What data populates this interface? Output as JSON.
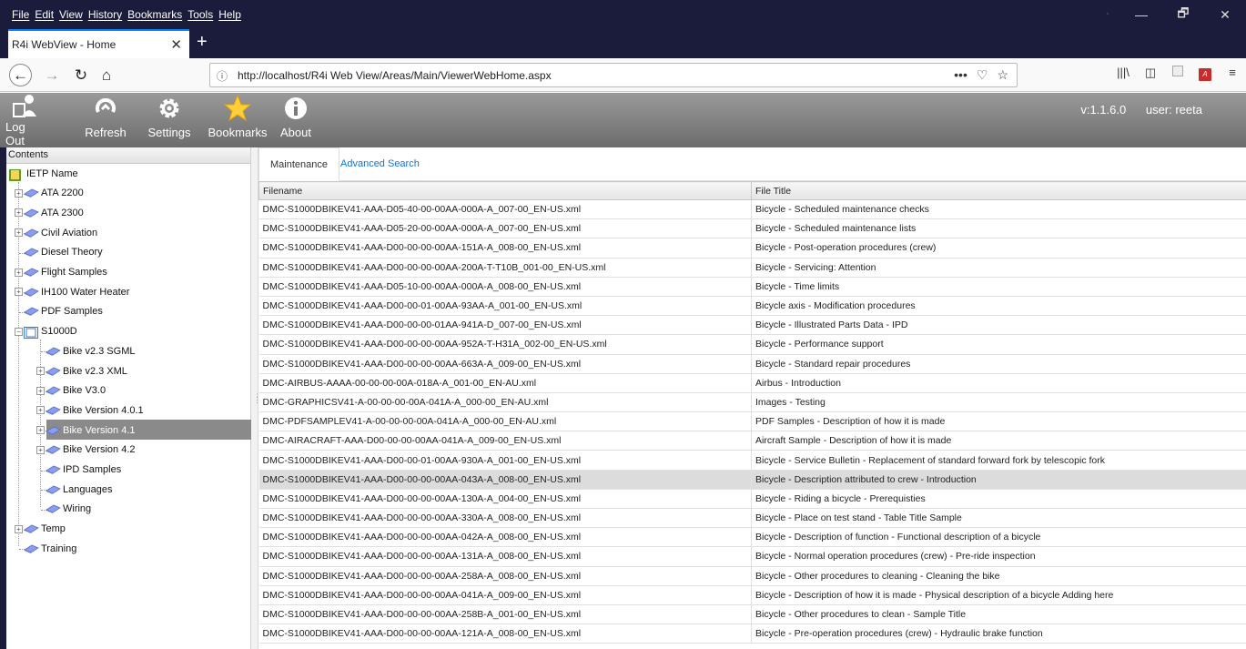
{
  "menubar": {
    "items": [
      "File",
      "Edit",
      "View",
      "History",
      "Bookmarks",
      "Tools",
      "Help"
    ]
  },
  "window_controls": {
    "minimize": "—",
    "maximize": "🗗",
    "close": "✕"
  },
  "browser": {
    "tab_title": "R4i WebView - Home",
    "url": "http://localhost/R4i Web View/Areas/Main/ViewerWebHome.aspx"
  },
  "toolbar": {
    "buttons": [
      {
        "label": "Log Out",
        "icon": "logout-icon"
      },
      {
        "label": "Refresh",
        "icon": "refresh-icon"
      },
      {
        "label": "Settings",
        "icon": "gear-icon"
      },
      {
        "label": "Bookmarks",
        "icon": "star-icon"
      },
      {
        "label": "About",
        "icon": "info-icon"
      }
    ],
    "version": "v:1.1.6.0",
    "user": "user: reeta"
  },
  "sidebar": {
    "header": "Contents",
    "tree": [
      {
        "label": "IETP Name",
        "level": 0,
        "icon": "root-book-icon"
      },
      {
        "label": "ATA 2200",
        "level": 1,
        "expandable": true
      },
      {
        "label": "ATA 2300",
        "level": 1,
        "expandable": true
      },
      {
        "label": "Civil Aviation",
        "level": 1,
        "expandable": true
      },
      {
        "label": "Diesel Theory",
        "level": 1,
        "expandable": false
      },
      {
        "label": "Flight Samples",
        "level": 1,
        "expandable": true
      },
      {
        "label": "IH100 Water Heater",
        "level": 1,
        "expandable": true
      },
      {
        "label": "PDF Samples",
        "level": 1,
        "expandable": false
      },
      {
        "label": "S1000D",
        "level": 1,
        "expandable": true,
        "expanded": true
      },
      {
        "label": "Bike v2.3 SGML",
        "level": 2,
        "expandable": false
      },
      {
        "label": "Bike v2.3 XML",
        "level": 2,
        "expandable": true
      },
      {
        "label": "Bike V3.0",
        "level": 2,
        "expandable": true
      },
      {
        "label": "Bike Version 4.0.1",
        "level": 2,
        "expandable": true
      },
      {
        "label": "Bike Version 4.1",
        "level": 2,
        "expandable": true,
        "selected": true
      },
      {
        "label": "Bike Version 4.2",
        "level": 2,
        "expandable": true
      },
      {
        "label": "IPD Samples",
        "level": 2,
        "expandable": false
      },
      {
        "label": "Languages",
        "level": 2,
        "expandable": false
      },
      {
        "label": "Wiring",
        "level": 2,
        "expandable": false
      },
      {
        "label": "Temp",
        "level": 1,
        "expandable": true
      },
      {
        "label": "Training",
        "level": 1,
        "expandable": false
      }
    ]
  },
  "main": {
    "tabs": [
      "Maintenance",
      "Advanced Search"
    ],
    "columns": [
      "Filename",
      "File Title"
    ],
    "rows": [
      [
        "DMC-S1000DBIKEV41-AAA-D05-40-00-00AA-000A-A_007-00_EN-US.xml",
        "Bicycle - Scheduled maintenance checks"
      ],
      [
        "DMC-S1000DBIKEV41-AAA-D05-20-00-00AA-000A-A_007-00_EN-US.xml",
        "Bicycle - Scheduled maintenance lists"
      ],
      [
        "DMC-S1000DBIKEV41-AAA-D00-00-00-00AA-151A-A_008-00_EN-US.xml",
        "Bicycle - Post-operation procedures (crew)"
      ],
      [
        "DMC-S1000DBIKEV41-AAA-D00-00-00-00AA-200A-T-T10B_001-00_EN-US.xml",
        "Bicycle - Servicing: Attention"
      ],
      [
        "DMC-S1000DBIKEV41-AAA-D05-10-00-00AA-000A-A_008-00_EN-US.xml",
        "Bicycle - Time limits"
      ],
      [
        "DMC-S1000DBIKEV41-AAA-D00-00-01-00AA-93AA-A_001-00_EN-US.xml",
        "Bicycle axis - Modification procedures"
      ],
      [
        "DMC-S1000DBIKEV41-AAA-D00-00-00-01AA-941A-D_007-00_EN-US.xml",
        "Bicycle - Illustrated Parts Data - IPD"
      ],
      [
        "DMC-S1000DBIKEV41-AAA-D00-00-00-00AA-952A-T-H31A_002-00_EN-US.xml",
        "Bicycle - Performance support"
      ],
      [
        "DMC-S1000DBIKEV41-AAA-D00-00-00-00AA-663A-A_009-00_EN-US.xml",
        "Bicycle - Standard repair procedures"
      ],
      [
        "DMC-AIRBUS-AAAA-00-00-00-00A-018A-A_001-00_EN-AU.xml",
        "Airbus - Introduction"
      ],
      [
        "DMC-GRAPHICSV41-A-00-00-00-00A-041A-A_000-00_EN-AU.xml",
        "Images - Testing"
      ],
      [
        "DMC-PDFSAMPLEV41-A-00-00-00-00A-041A-A_000-00_EN-AU.xml",
        "PDF Samples - Description of how it is made"
      ],
      [
        "DMC-AIRACRAFT-AAA-D00-00-00-00AA-041A-A_009-00_EN-US.xml",
        "Aircraft Sample - Description of how it is made"
      ],
      [
        "DMC-S1000DBIKEV41-AAA-D00-00-01-00AA-930A-A_001-00_EN-US.xml",
        "Bicycle - Service Bulletin - Replacement of standard forward fork by telescopic fork"
      ],
      [
        "DMC-S1000DBIKEV41-AAA-D00-00-00-00AA-043A-A_008-00_EN-US.xml",
        "Bicycle - Description attributed to crew - Introduction"
      ],
      [
        "DMC-S1000DBIKEV41-AAA-D00-00-00-00AA-130A-A_004-00_EN-US.xml",
        "Bicycle - Riding a bicycle - Prerequisties"
      ],
      [
        "DMC-S1000DBIKEV41-AAA-D00-00-00-00AA-330A-A_008-00_EN-US.xml",
        "Bicycle - Place on test stand - Table Title Sample"
      ],
      [
        "DMC-S1000DBIKEV41-AAA-D00-00-00-00AA-042A-A_008-00_EN-US.xml",
        "Bicycle - Description of function - Functional description of a bicycle"
      ],
      [
        "DMC-S1000DBIKEV41-AAA-D00-00-00-00AA-131A-A_008-00_EN-US.xml",
        "Bicycle - Normal operation procedures (crew) - Pre-ride inspection"
      ],
      [
        "DMC-S1000DBIKEV41-AAA-D00-00-00-00AA-258A-A_008-00_EN-US.xml",
        "Bicycle - Other procedures to cleaning - Cleaning the bike"
      ],
      [
        "DMC-S1000DBIKEV41-AAA-D00-00-00-00AA-041A-A_009-00_EN-US.xml",
        "Bicycle - Description of how it is made - Physical description of a bicycle Adding here"
      ],
      [
        "DMC-S1000DBIKEV41-AAA-D00-00-00-00AA-258B-A_001-00_EN-US.xml",
        "Bicycle - Other procedures to clean - Sample Title"
      ],
      [
        "DMC-S1000DBIKEV41-AAA-D00-00-00-00AA-121A-A_008-00_EN-US.xml",
        "Bicycle - Pre-operation procedures (crew) - Hydraulic brake function"
      ]
    ],
    "highlighted_row": 14
  }
}
